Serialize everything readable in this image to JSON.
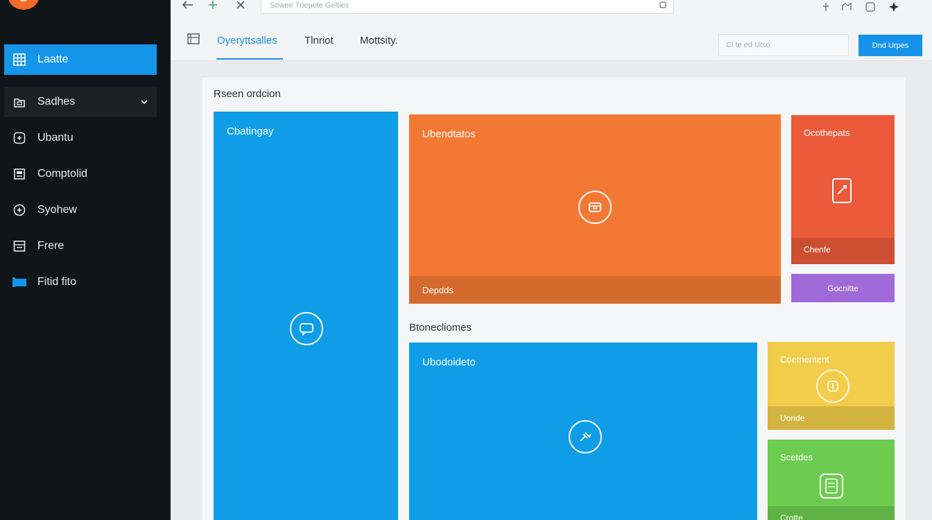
{
  "sidebar": {
    "items": [
      {
        "label": "Laatte",
        "icon": "grid-icon",
        "active": true
      },
      {
        "label": "Sadhes",
        "icon": "folder-icon",
        "expandable": true
      },
      {
        "label": "Ubantu",
        "icon": "plus-square-icon"
      },
      {
        "label": "Comptolid",
        "icon": "document-icon"
      },
      {
        "label": "Syohew",
        "icon": "add-circle-icon"
      },
      {
        "label": "Frere",
        "icon": "list-icon"
      },
      {
        "label": "Fitid fito",
        "icon": "flag-icon"
      }
    ]
  },
  "topbar": {
    "address_text": "Sowee Tnepote Gelties",
    "icons": [
      "back-arrow-icon",
      "puzzle-icon",
      "close-icon",
      "search-icon",
      "pin-icon",
      "bookmark-icon",
      "share-icon",
      "sparkle-icon"
    ]
  },
  "header": {
    "tabs": [
      {
        "label": "Oyeryttsalles",
        "active": true
      },
      {
        "label": "Tlnriot"
      },
      {
        "label": "Mottsity."
      }
    ],
    "search_placeholder": "Cl te ed Utso",
    "primary_button": "Dnd Urpes"
  },
  "content": {
    "section1_title": "Rseen ordcion",
    "section2_title": "Btonecliomes",
    "tiles": {
      "blue_tall": {
        "label": "Cbatingay"
      },
      "orange": {
        "label": "Ubendtatos",
        "footer": "Depdds"
      },
      "red": {
        "label": "Ocothepats",
        "footer": "Chenfe"
      },
      "purple": {
        "label": "Gocnitte"
      },
      "blue_wide": {
        "label": "Ubodoideto"
      },
      "yellow": {
        "label": "Coetnentent",
        "footer": "Uonde"
      },
      "green": {
        "label": "Scetdes",
        "footer": "Crotte"
      }
    }
  },
  "colors": {
    "sidebar_bg": "#0f1519",
    "accent_blue": "#1595ea",
    "tile_blue": "#0f9de8",
    "tile_orange": "#f27934",
    "tile_red": "#ea5a3b",
    "tile_purple": "#a06ad9",
    "tile_yellow": "#f1cd4b",
    "tile_green": "#6dcc4f"
  }
}
